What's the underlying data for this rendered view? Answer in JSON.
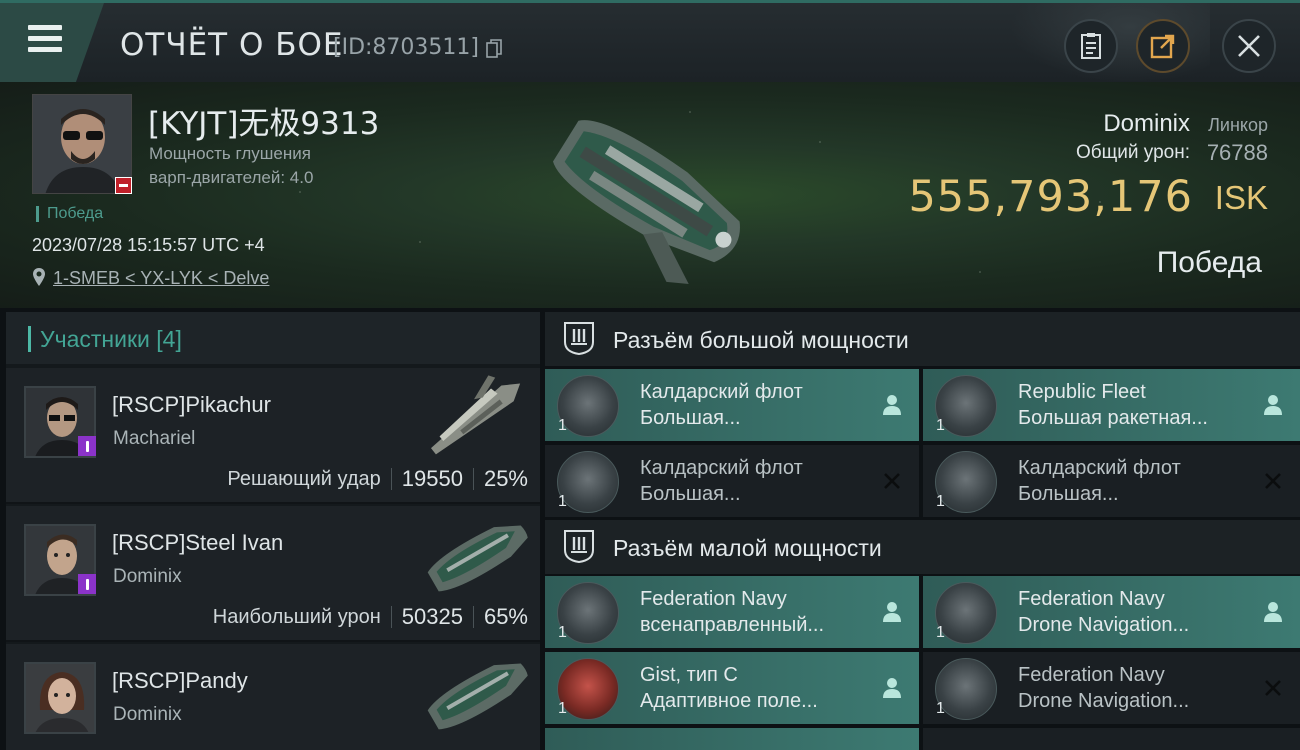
{
  "window": {
    "title": "ОТЧЁТ О БОЕ",
    "report_id": "[ID:8703511]",
    "icons": [
      "menu-icon",
      "copy-icon",
      "clipboard-icon",
      "share-icon",
      "close-icon"
    ]
  },
  "victim": {
    "name": "[KYJT]无极9313",
    "attribute_line1": "Мощность глушения",
    "attribute_line2": "варп-двигателей: 4.0",
    "status_tag": "Победа",
    "datetime": "2023/07/28 15:15:57 UTC +4",
    "location": "1-SMEB < YX-LYK < Delve",
    "ship_name": "Dominix",
    "ship_class": "Линкор",
    "total_damage_label": "Общий урон:",
    "total_damage_value": "76788",
    "isk_value": "555,793,176",
    "isk_unit": "ISK",
    "result": "Победа"
  },
  "participants": {
    "header": "Участники [4]",
    "items": [
      {
        "name": "[RSCP]Pikachur",
        "ship": "Machariel",
        "role": "Решающий удар",
        "damage": "19550",
        "percent": "25%"
      },
      {
        "name": "[RSCP]Steel Ivan",
        "ship": "Dominix",
        "role": "Наибольший урон",
        "damage": "50325",
        "percent": "65%"
      },
      {
        "name": "[RSCP]Pandy",
        "ship": "Dominix",
        "role": "",
        "damage": "",
        "percent": ""
      }
    ]
  },
  "high_slots": {
    "header": "Разъём большой мощности",
    "modules": [
      {
        "line1": "Калдарский флот",
        "line2": "Большая...",
        "qty": "1",
        "state": "fitted"
      },
      {
        "line1": "Republic Fleet",
        "line2": "Большая ракетная...",
        "qty": "1",
        "state": "fitted"
      },
      {
        "line1": "Калдарский флот",
        "line2": "Большая...",
        "qty": "1",
        "state": "destroyed"
      },
      {
        "line1": "Калдарский флот",
        "line2": "Большая...",
        "qty": "1",
        "state": "destroyed"
      }
    ]
  },
  "low_slots": {
    "header": "Разъём малой мощности",
    "modules": [
      {
        "line1": "Federation Navy",
        "line2": "всенаправленный...",
        "qty": "1",
        "state": "fitted"
      },
      {
        "line1": "Federation Navy",
        "line2": "Drone Navigation...",
        "qty": "1",
        "state": "fitted"
      },
      {
        "line1": "Gist, тип C",
        "line2": "Адаптивное поле...",
        "qty": "1",
        "state": "fitted"
      },
      {
        "line1": "Federation Navy",
        "line2": "Drone Navigation...",
        "qty": "1",
        "state": "destroyed"
      }
    ]
  },
  "colors": {
    "accent": "#43a595",
    "isk": "#e5c677",
    "fitted_bg": "#3d7a72",
    "badge_purple": "#8b33c9",
    "badge_red": "#c0202a"
  }
}
